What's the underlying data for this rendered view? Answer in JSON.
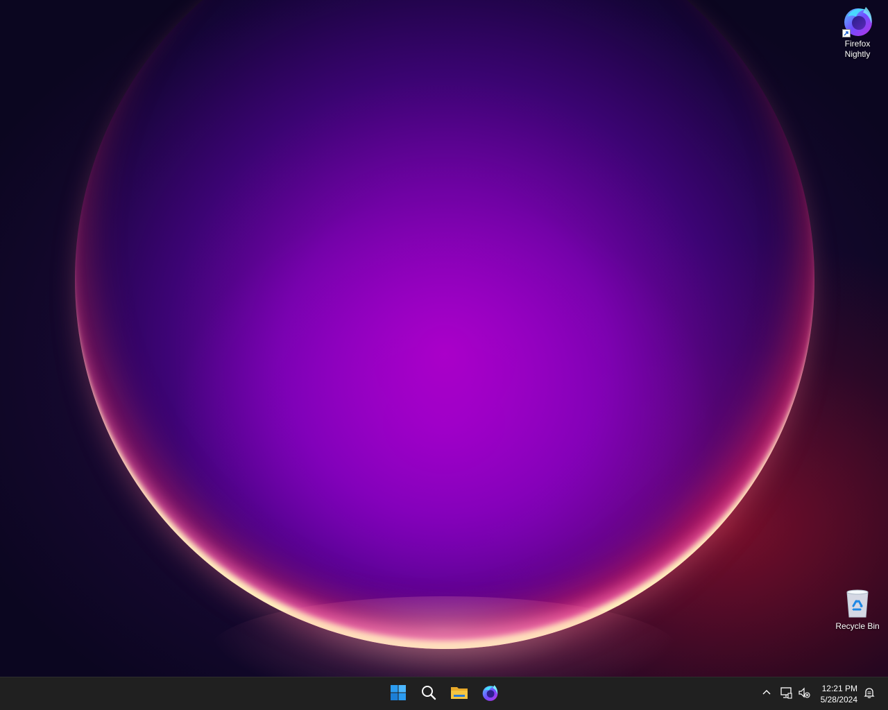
{
  "desktop": {
    "icons": [
      {
        "label": "Firefox Nightly",
        "icon": "firefox-nightly-icon",
        "shortcut": true
      },
      {
        "label": "Recycle Bin",
        "icon": "recycle-bin-icon"
      }
    ]
  },
  "taskbar": {
    "pinned": [
      {
        "name": "start",
        "icon": "windows-logo-icon"
      },
      {
        "name": "search",
        "icon": "search-icon"
      },
      {
        "name": "file-explorer",
        "icon": "folder-icon"
      },
      {
        "name": "firefox-nightly",
        "icon": "firefox-nightly-icon"
      }
    ],
    "tray": {
      "time": "12:21 PM",
      "date": "5/28/2024"
    }
  },
  "colors": {
    "taskbar_bg": "#202020",
    "windows_blue": "#2b8be8",
    "folder_yellow": "#f5c640"
  }
}
